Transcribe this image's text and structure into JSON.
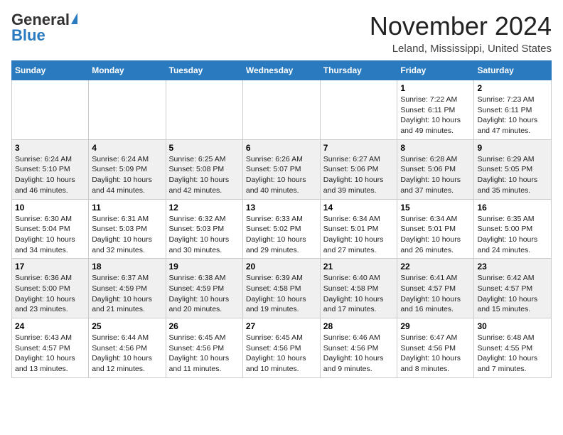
{
  "header": {
    "logo_general": "General",
    "logo_blue": "Blue",
    "title": "November 2024",
    "location": "Leland, Mississippi, United States"
  },
  "days_of_week": [
    "Sunday",
    "Monday",
    "Tuesday",
    "Wednesday",
    "Thursday",
    "Friday",
    "Saturday"
  ],
  "weeks": [
    [
      {
        "day": "",
        "text": ""
      },
      {
        "day": "",
        "text": ""
      },
      {
        "day": "",
        "text": ""
      },
      {
        "day": "",
        "text": ""
      },
      {
        "day": "",
        "text": ""
      },
      {
        "day": "1",
        "text": "Sunrise: 7:22 AM\nSunset: 6:11 PM\nDaylight: 10 hours and 49 minutes."
      },
      {
        "day": "2",
        "text": "Sunrise: 7:23 AM\nSunset: 6:11 PM\nDaylight: 10 hours and 47 minutes."
      }
    ],
    [
      {
        "day": "3",
        "text": "Sunrise: 6:24 AM\nSunset: 5:10 PM\nDaylight: 10 hours and 46 minutes."
      },
      {
        "day": "4",
        "text": "Sunrise: 6:24 AM\nSunset: 5:09 PM\nDaylight: 10 hours and 44 minutes."
      },
      {
        "day": "5",
        "text": "Sunrise: 6:25 AM\nSunset: 5:08 PM\nDaylight: 10 hours and 42 minutes."
      },
      {
        "day": "6",
        "text": "Sunrise: 6:26 AM\nSunset: 5:07 PM\nDaylight: 10 hours and 40 minutes."
      },
      {
        "day": "7",
        "text": "Sunrise: 6:27 AM\nSunset: 5:06 PM\nDaylight: 10 hours and 39 minutes."
      },
      {
        "day": "8",
        "text": "Sunrise: 6:28 AM\nSunset: 5:06 PM\nDaylight: 10 hours and 37 minutes."
      },
      {
        "day": "9",
        "text": "Sunrise: 6:29 AM\nSunset: 5:05 PM\nDaylight: 10 hours and 35 minutes."
      }
    ],
    [
      {
        "day": "10",
        "text": "Sunrise: 6:30 AM\nSunset: 5:04 PM\nDaylight: 10 hours and 34 minutes."
      },
      {
        "day": "11",
        "text": "Sunrise: 6:31 AM\nSunset: 5:03 PM\nDaylight: 10 hours and 32 minutes."
      },
      {
        "day": "12",
        "text": "Sunrise: 6:32 AM\nSunset: 5:03 PM\nDaylight: 10 hours and 30 minutes."
      },
      {
        "day": "13",
        "text": "Sunrise: 6:33 AM\nSunset: 5:02 PM\nDaylight: 10 hours and 29 minutes."
      },
      {
        "day": "14",
        "text": "Sunrise: 6:34 AM\nSunset: 5:01 PM\nDaylight: 10 hours and 27 minutes."
      },
      {
        "day": "15",
        "text": "Sunrise: 6:34 AM\nSunset: 5:01 PM\nDaylight: 10 hours and 26 minutes."
      },
      {
        "day": "16",
        "text": "Sunrise: 6:35 AM\nSunset: 5:00 PM\nDaylight: 10 hours and 24 minutes."
      }
    ],
    [
      {
        "day": "17",
        "text": "Sunrise: 6:36 AM\nSunset: 5:00 PM\nDaylight: 10 hours and 23 minutes."
      },
      {
        "day": "18",
        "text": "Sunrise: 6:37 AM\nSunset: 4:59 PM\nDaylight: 10 hours and 21 minutes."
      },
      {
        "day": "19",
        "text": "Sunrise: 6:38 AM\nSunset: 4:59 PM\nDaylight: 10 hours and 20 minutes."
      },
      {
        "day": "20",
        "text": "Sunrise: 6:39 AM\nSunset: 4:58 PM\nDaylight: 10 hours and 19 minutes."
      },
      {
        "day": "21",
        "text": "Sunrise: 6:40 AM\nSunset: 4:58 PM\nDaylight: 10 hours and 17 minutes."
      },
      {
        "day": "22",
        "text": "Sunrise: 6:41 AM\nSunset: 4:57 PM\nDaylight: 10 hours and 16 minutes."
      },
      {
        "day": "23",
        "text": "Sunrise: 6:42 AM\nSunset: 4:57 PM\nDaylight: 10 hours and 15 minutes."
      }
    ],
    [
      {
        "day": "24",
        "text": "Sunrise: 6:43 AM\nSunset: 4:57 PM\nDaylight: 10 hours and 13 minutes."
      },
      {
        "day": "25",
        "text": "Sunrise: 6:44 AM\nSunset: 4:56 PM\nDaylight: 10 hours and 12 minutes."
      },
      {
        "day": "26",
        "text": "Sunrise: 6:45 AM\nSunset: 4:56 PM\nDaylight: 10 hours and 11 minutes."
      },
      {
        "day": "27",
        "text": "Sunrise: 6:45 AM\nSunset: 4:56 PM\nDaylight: 10 hours and 10 minutes."
      },
      {
        "day": "28",
        "text": "Sunrise: 6:46 AM\nSunset: 4:56 PM\nDaylight: 10 hours and 9 minutes."
      },
      {
        "day": "29",
        "text": "Sunrise: 6:47 AM\nSunset: 4:56 PM\nDaylight: 10 hours and 8 minutes."
      },
      {
        "day": "30",
        "text": "Sunrise: 6:48 AM\nSunset: 4:55 PM\nDaylight: 10 hours and 7 minutes."
      }
    ]
  ]
}
